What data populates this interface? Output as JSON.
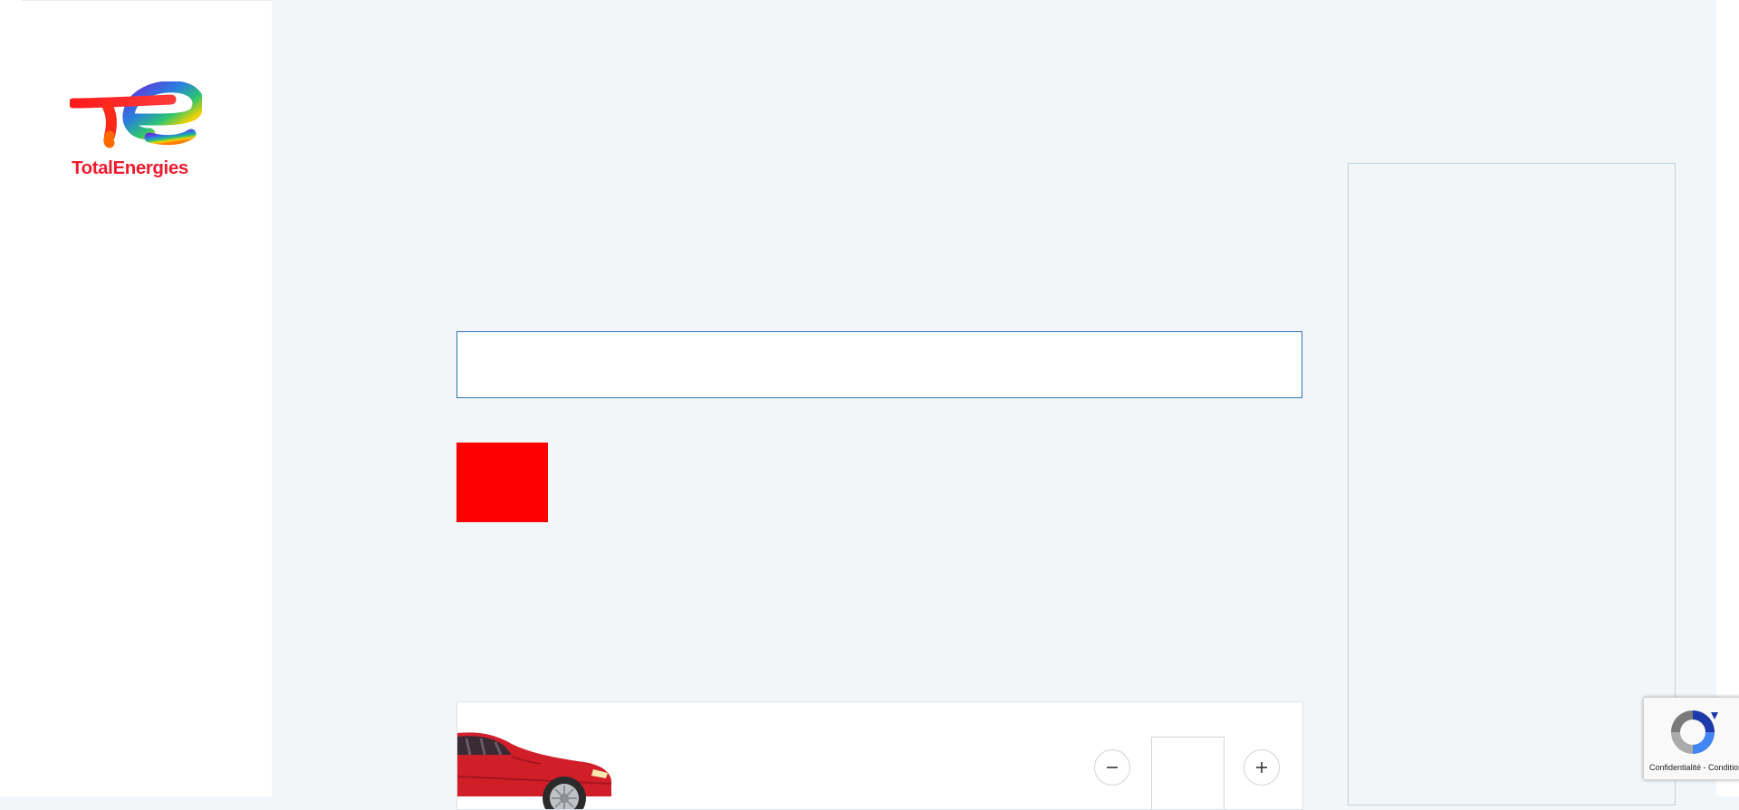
{
  "brand": {
    "name": "TotalEnergies",
    "colors": {
      "red": "#ee1b2e",
      "blue": "#2a76b6",
      "panel_bg": "#f3f6f9"
    }
  },
  "search": {
    "value": "",
    "placeholder": ""
  },
  "product": {
    "image": "red-car-icon",
    "quantity": "",
    "minus_icon": "minus-icon",
    "plus_icon": "plus-icon"
  },
  "recaptcha": {
    "privacy_label": "Confidentialité",
    "separator": " - ",
    "terms_label": "Conditions"
  }
}
